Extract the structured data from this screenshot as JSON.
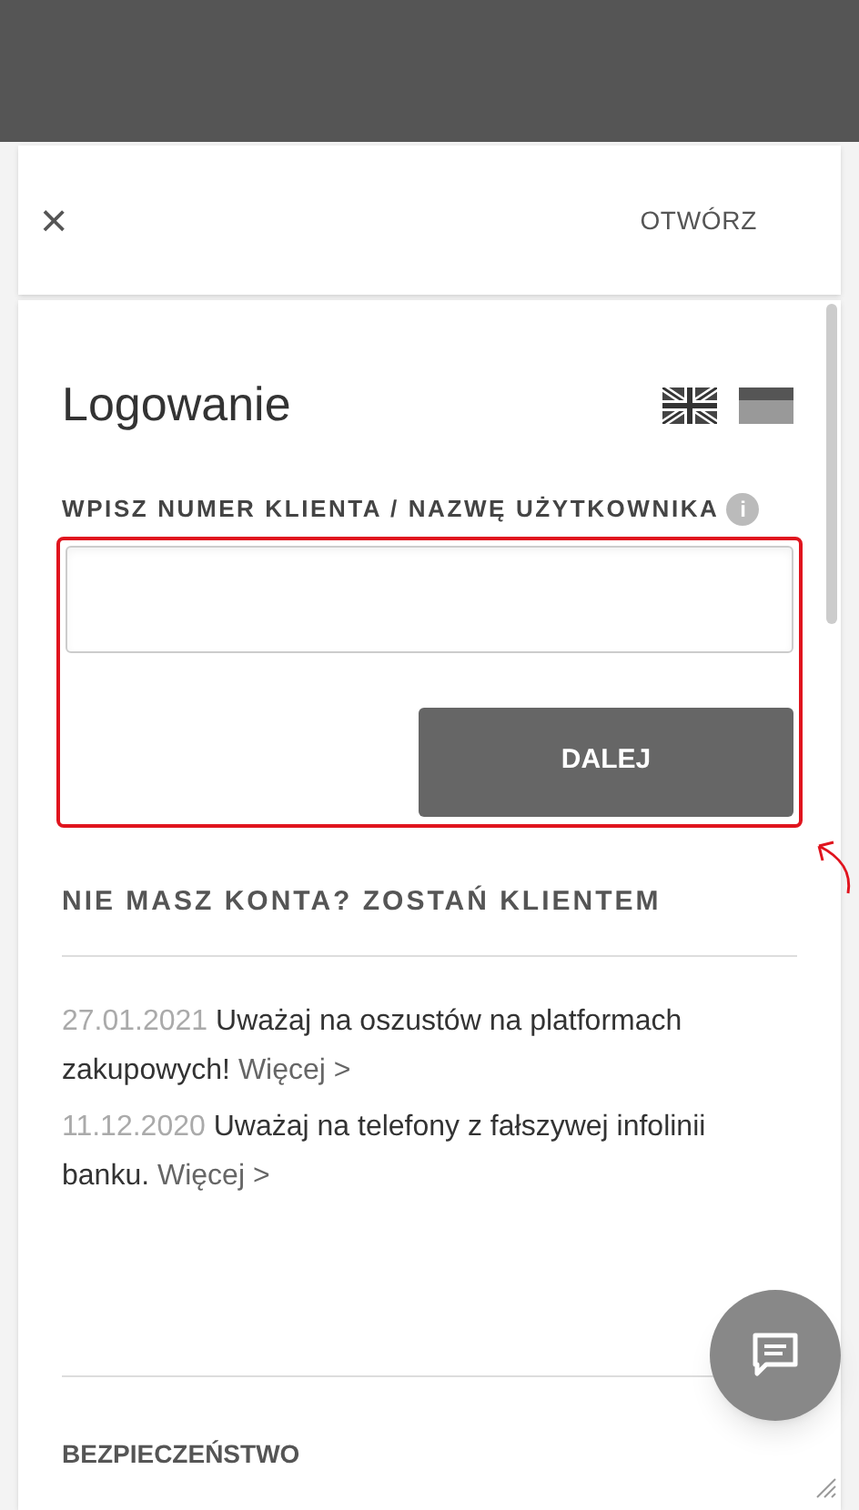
{
  "header": {
    "close": "×",
    "action": "OTWÓRZ"
  },
  "login": {
    "title": "Logowanie",
    "languages": [
      {
        "kind": "uk"
      },
      {
        "kind": "de"
      }
    ],
    "field_label": "WPISZ NUMER KLIENTA / NAZWĘ UŻYTKOWNIKA",
    "info": "i",
    "button": "DALEJ"
  },
  "register_link": "NIE MASZ KONTA? ZOSTAŃ KLIENTEM",
  "news": [
    {
      "date": "27.01.2021",
      "text": "Uważaj na oszustów na platformach zakupowych!",
      "link": "Więcej >"
    },
    {
      "date": "11.12.2020",
      "text": "Uważaj na telefony z fałszywej infolinii banku.",
      "link": "Więcej >"
    }
  ],
  "section": "BEZPIECZEŃSTWO"
}
